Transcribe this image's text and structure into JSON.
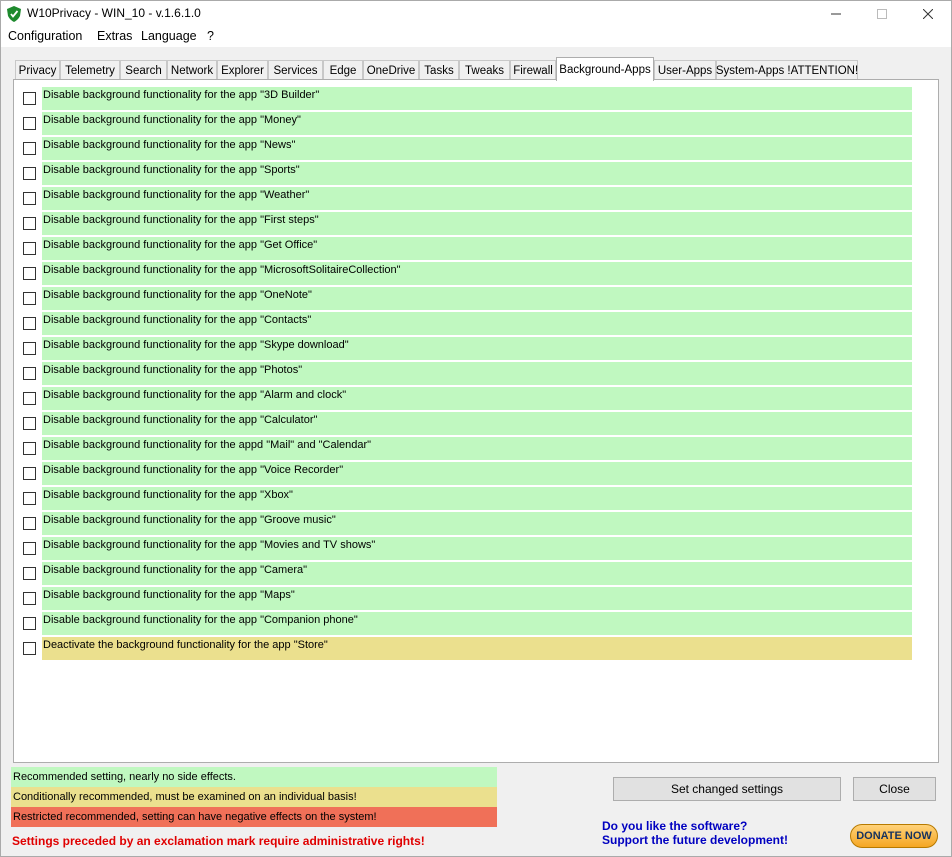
{
  "window": {
    "title": "W10Privacy - WIN_10 - v.1.6.1.0"
  },
  "menu": [
    "Configuration",
    "Extras",
    "Language",
    "?"
  ],
  "tabs": [
    "Privacy",
    "Telemetry",
    "Search",
    "Network",
    "Explorer",
    "Services",
    "Edge",
    "OneDrive",
    "Tasks",
    "Tweaks",
    "Firewall",
    "Background-Apps",
    "User-Apps",
    "System-Apps !ATTENTION!"
  ],
  "active_tab": "Background-Apps",
  "settings": [
    {
      "label": "Disable background functionality for the app \"3D Builder\"",
      "level": "green",
      "checked": false
    },
    {
      "label": "Disable background functionality for the app \"Money\"",
      "level": "green",
      "checked": false
    },
    {
      "label": "Disable background functionality for the app \"News\"",
      "level": "green",
      "checked": false
    },
    {
      "label": "Disable background functionality for the app \"Sports\"",
      "level": "green",
      "checked": false
    },
    {
      "label": "Disable background functionality for the app \"Weather\"",
      "level": "green",
      "checked": false
    },
    {
      "label": "Disable background functionality for the app \"First steps\"",
      "level": "green",
      "checked": false
    },
    {
      "label": "Disable background functionality for the app \"Get Office\"",
      "level": "green",
      "checked": false
    },
    {
      "label": "Disable background functionality for the app \"MicrosoftSolitaireCollection\"",
      "level": "green",
      "checked": false
    },
    {
      "label": "Disable background functionality for the app \"OneNote\"",
      "level": "green",
      "checked": false
    },
    {
      "label": "Disable background functionality for the app \"Contacts\"",
      "level": "green",
      "checked": false
    },
    {
      "label": "Disable background functionality for the app \"Skype download\"",
      "level": "green",
      "checked": false
    },
    {
      "label": "Disable background functionality for the app \"Photos\"",
      "level": "green",
      "checked": false
    },
    {
      "label": "Disable background functionality for the app \"Alarm and clock\"",
      "level": "green",
      "checked": false
    },
    {
      "label": "Disable background functionality for the app \"Calculator\"",
      "level": "green",
      "checked": false
    },
    {
      "label": "Disable background functionality for the appd \"Mail\" and \"Calendar\"",
      "level": "green",
      "checked": false
    },
    {
      "label": "Disable background functionality for the app \"Voice Recorder\"",
      "level": "green",
      "checked": false
    },
    {
      "label": "Disable background functionality for the app \"Xbox\"",
      "level": "green",
      "checked": false
    },
    {
      "label": "Disable background functionality for the app \"Groove music\"",
      "level": "green",
      "checked": false
    },
    {
      "label": "Disable background functionality for the app \"Movies and TV shows\"",
      "level": "green",
      "checked": false
    },
    {
      "label": "Disable background functionality for the app \"Camera\"",
      "level": "green",
      "checked": false
    },
    {
      "label": "Disable background functionality for the app \"Maps\"",
      "level": "green",
      "checked": false
    },
    {
      "label": "Disable background functionality for the app \"Companion phone\"",
      "level": "green",
      "checked": false
    },
    {
      "label": "Deactivate the background functionality for the app \"Store\"",
      "level": "yellow",
      "checked": false
    }
  ],
  "legend": {
    "green": "Recommended setting, nearly no side effects.",
    "yellow": "Conditionally recommended, must be examined on an individual basis!",
    "red": "Restricted recommended, setting can have negative effects on the system!"
  },
  "admin_note": "Settings preceded by an exclamation mark require administrative rights!",
  "buttons": {
    "set": "Set changed settings",
    "close": "Close"
  },
  "donate": {
    "line1": "Do you like the software?",
    "line2": "Support the future development!",
    "button": "DONATE NOW"
  },
  "colors": {
    "green": "#c0f8c0",
    "yellow": "#ebe08e",
    "red": "#f07058"
  }
}
